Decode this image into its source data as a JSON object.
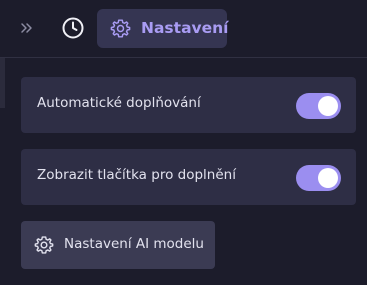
{
  "toolbar": {
    "expand_icon": "double-chevron-right-icon",
    "history_icon": "clock-icon",
    "settings_tab": {
      "icon": "gear-icon",
      "label": "Nastavení",
      "active": true
    }
  },
  "settings": [
    {
      "label": "Automatické doplňování",
      "toggle_on": true
    },
    {
      "label": "Zobrazit tlačítka pro doplnění",
      "toggle_on": true
    }
  ],
  "ai_model_button": {
    "icon": "gear-icon",
    "label": "Nastavení AI modelu"
  },
  "colors": {
    "background": "#1c1c2b",
    "card": "#2e2e45",
    "button": "#3b3b53",
    "active_tab": "#353552",
    "accent": "#a99cf3",
    "toggle_on": "#9b8ef0",
    "text": "#e2e2ee"
  }
}
